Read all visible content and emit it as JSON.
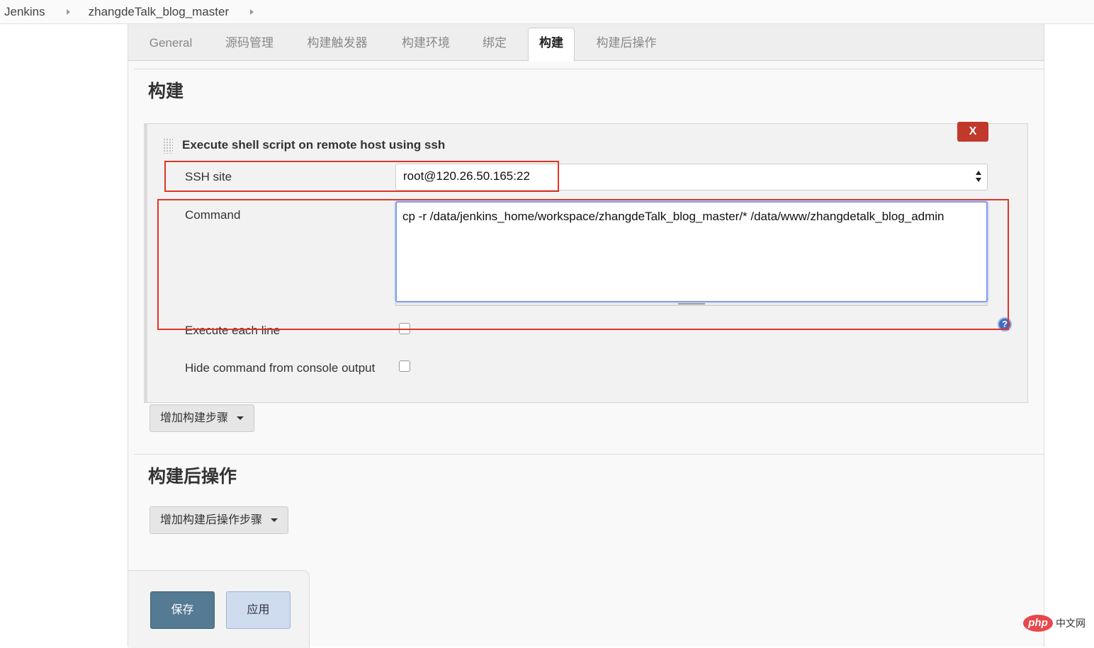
{
  "breadcrumb": {
    "items": [
      "Jenkins",
      "zhangdeTalk_blog_master"
    ]
  },
  "tabs": [
    {
      "label": "General"
    },
    {
      "label": "源码管理"
    },
    {
      "label": "构建触发器"
    },
    {
      "label": "构建环境"
    },
    {
      "label": "绑定"
    },
    {
      "label": "构建",
      "active": true
    },
    {
      "label": "构建后操作"
    }
  ],
  "build": {
    "section_title": "构建",
    "step": {
      "title": "Execute shell script on remote host using ssh",
      "delete_label": "X",
      "ssh_site_label": "SSH site",
      "ssh_site_value": "root@120.26.50.165:22",
      "command_label": "Command",
      "command_value": "cp -r /data/jenkins_home/workspace/zhangdeTalk_blog_master/* /data/www/zhangdetalk_blog_admin",
      "execute_each_line_label": "Execute each line",
      "execute_each_line_checked": false,
      "hide_command_label": "Hide command from console output",
      "hide_command_checked": false,
      "help_label": "?"
    },
    "add_step_label": "增加构建步骤"
  },
  "post_build": {
    "section_title": "构建后操作",
    "add_step_label": "增加构建后操作步骤"
  },
  "actions": {
    "save_label": "保存",
    "apply_label": "应用"
  },
  "watermark": {
    "logo_text": "php",
    "text": "中文网"
  },
  "colors": {
    "annotation": "#e03527",
    "save_button": "#557a93",
    "apply_button": "#cfdcef",
    "delete_button": "#c0392b"
  }
}
